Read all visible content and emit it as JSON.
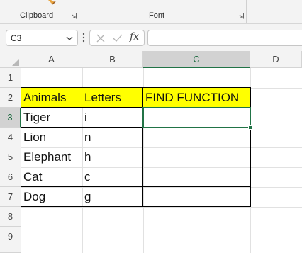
{
  "ribbon": {
    "groups": [
      {
        "label": "Clipboard",
        "icon": "paint-brush-icon",
        "launcher_icon": "dialog-launcher-icon"
      },
      {
        "label": "Font",
        "launcher_icon": "dialog-launcher-icon"
      }
    ]
  },
  "formula_bar": {
    "name_box": "C3",
    "fx_label": "fx",
    "formula_value": ""
  },
  "sheet": {
    "columns": [
      "A",
      "B",
      "C",
      "D"
    ],
    "selected_column": "C",
    "rows": [
      "1",
      "2",
      "3",
      "4",
      "5",
      "6",
      "7",
      "8",
      "9"
    ],
    "selected_row": "3",
    "table": {
      "headers": [
        "Animals",
        "Letters",
        "FIND FUNCTION"
      ],
      "rows": [
        {
          "animal": "Tiger",
          "letter": "i",
          "find": ""
        },
        {
          "animal": "Lion",
          "letter": "n",
          "find": ""
        },
        {
          "animal": "Elephant",
          "letter": "h",
          "find": ""
        },
        {
          "animal": "Cat",
          "letter": "c",
          "find": ""
        },
        {
          "animal": "Dog",
          "letter": "g",
          "find": ""
        }
      ]
    },
    "active_cell": "C3"
  },
  "colors": {
    "header_fill": "#ffff00",
    "selection_accent": "#217346",
    "border": "#000000"
  }
}
